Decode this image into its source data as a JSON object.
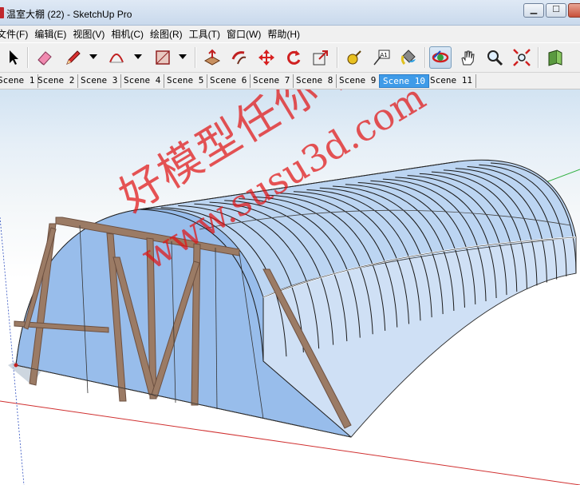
{
  "window": {
    "title": "温室大棚 (22) - SketchUp Pro",
    "controls": {
      "minimize": "▁",
      "maximize": "☐"
    }
  },
  "menu": {
    "items": [
      "文件(F)",
      "编辑(E)",
      "视图(V)",
      "相机(C)",
      "绘图(R)",
      "工具(T)",
      "窗口(W)",
      "帮助(H)"
    ]
  },
  "toolbar": {
    "tools": [
      "select-arrow-icon",
      "eraser-icon",
      "pencil-line-icon",
      "arc-icon",
      "rectangle-icon",
      "push-pull-icon",
      "follow-me-icon",
      "move-icon",
      "rotate-icon",
      "offset-scale-icon",
      "tape-measure-icon",
      "dimension-text-icon",
      "paint-bucket-icon",
      "orbit-icon",
      "pan-hand-icon",
      "zoom-icon",
      "zoom-extents-icon",
      "components-icon"
    ],
    "text_tool_label": "A1",
    "active_tool": "orbit-icon"
  },
  "scenes": {
    "tabs": [
      "Scene 1",
      "Scene 2",
      "Scene 3",
      "Scene 4",
      "Scene 5",
      "Scene 6",
      "Scene 7",
      "Scene 8",
      "Scene 9",
      "Scene 10",
      "Scene 11"
    ],
    "active": "Scene 10"
  },
  "viewport": {
    "watermark_cn": "好模型任你下",
    "watermark_url": "www.susu3d.com",
    "colors": {
      "glass": "#9fc3ee",
      "frame": "#8a6a55",
      "watermark": "#e01414",
      "axis_red": "#d03030",
      "axis_green": "#30b040"
    }
  }
}
